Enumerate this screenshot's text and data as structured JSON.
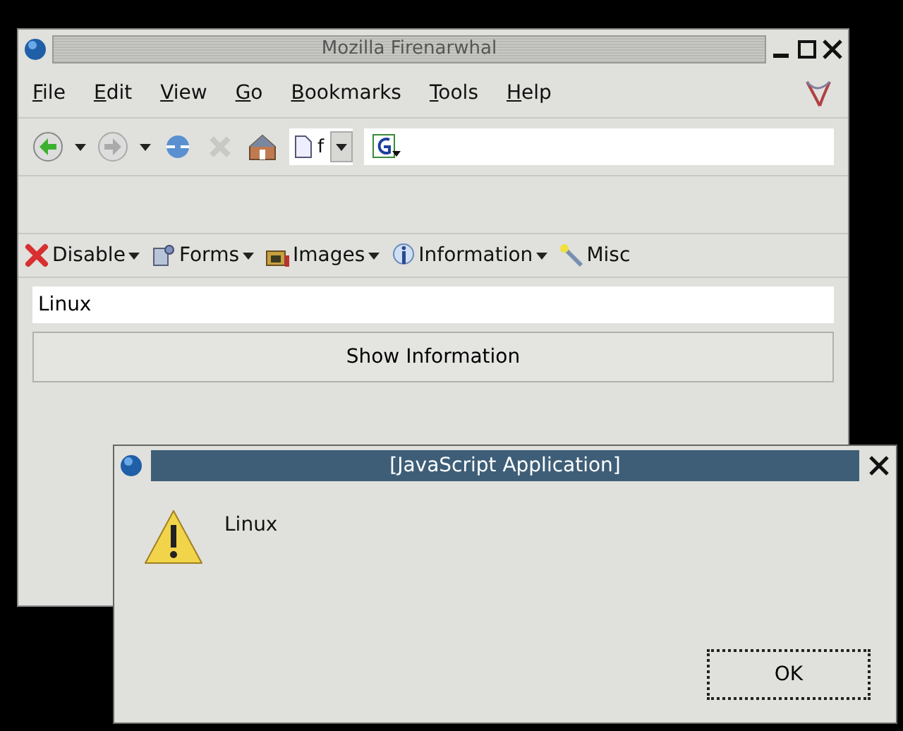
{
  "window": {
    "title": "Mozilla Firenarwhal"
  },
  "menu": [
    "File",
    "Edit",
    "View",
    "Go",
    "Bookmarks",
    "Tools",
    "Help"
  ],
  "navigation": {
    "address": "f"
  },
  "dev_toolbar": [
    {
      "label": "Disable",
      "kind": "disable"
    },
    {
      "label": "Forms",
      "kind": "forms"
    },
    {
      "label": "Images",
      "kind": "images"
    },
    {
      "label": "Information",
      "kind": "information"
    },
    {
      "label": "Misc",
      "kind": "misc"
    }
  ],
  "page": {
    "field": {
      "value": "Linux"
    },
    "button": "Show Information"
  },
  "dialog": {
    "title": "[JavaScript Application]",
    "message": "Linux",
    "button": "OK"
  }
}
